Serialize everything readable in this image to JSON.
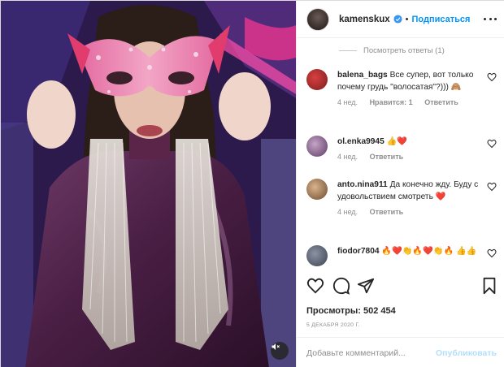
{
  "header": {
    "username": "kamenskux",
    "separator": "•",
    "follow_label": "Подписаться"
  },
  "view_replies": "Посмотреть ответы (1)",
  "comments": [
    {
      "username": "balena_bags",
      "text": "Все супер, вот только почему грудь \"волосатая\"?))) 🙈",
      "time": "4 нед.",
      "likes": "Нравится: 1",
      "reply": "Ответить"
    },
    {
      "username": "ol.enka9945",
      "text": "👍❤️",
      "time": "4 нед.",
      "reply": "Ответить"
    },
    {
      "username": "anto.nina911",
      "text": "Да конечно жду. Буду с удовольствием смотреть ❤️",
      "time": "4 нед.",
      "reply": "Ответить"
    },
    {
      "username": "fiodor7804",
      "text": "🔥❤️👏🔥❤️👏🔥 👍👍"
    }
  ],
  "post": {
    "views_label": "Просмотры: 502 454",
    "date": "5 декабря 2020 г."
  },
  "add_comment": {
    "placeholder": "Добавьте комментарий...",
    "post_label": "Опубликовать"
  },
  "colors": {
    "accent": "#0095f6",
    "post_disabled": "#b2dffc",
    "muted": "#8e8e8e"
  },
  "icons": [
    "verified-badge-icon",
    "more-options-icon",
    "heart-icon",
    "comment-icon",
    "share-icon",
    "bookmark-icon",
    "mute-icon"
  ]
}
